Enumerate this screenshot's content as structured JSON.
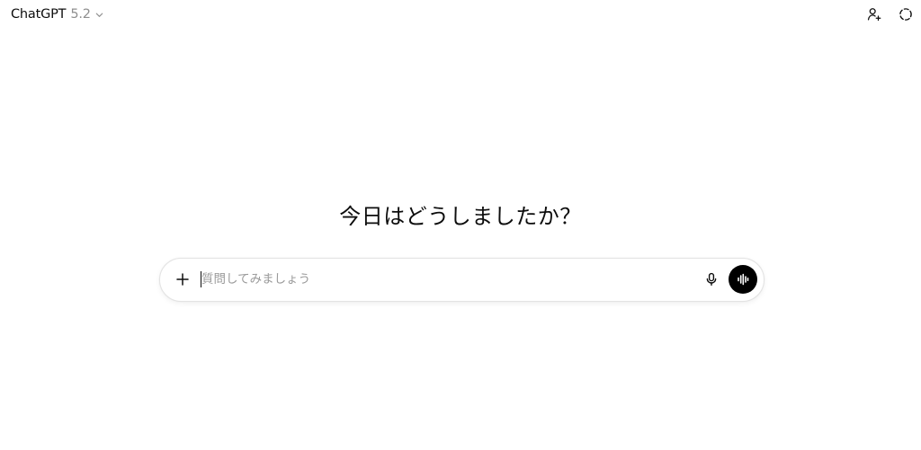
{
  "header": {
    "model_name": "ChatGPT",
    "model_version": "5.2",
    "icons": {
      "model_chevron": "chevron-down-icon",
      "invite": "person-add-icon",
      "temporary_chat": "dashed-circle-icon"
    }
  },
  "main": {
    "greeting": "今日はどうしましたか？"
  },
  "composer": {
    "placeholder": "質問してみましょう",
    "value": "",
    "icons": {
      "attach": "plus-icon",
      "dictate": "microphone-icon",
      "voice_mode": "voice-waveform-icon"
    },
    "colors": {
      "voice_button_bg": "#000000",
      "placeholder": "#9a9a9a"
    }
  }
}
